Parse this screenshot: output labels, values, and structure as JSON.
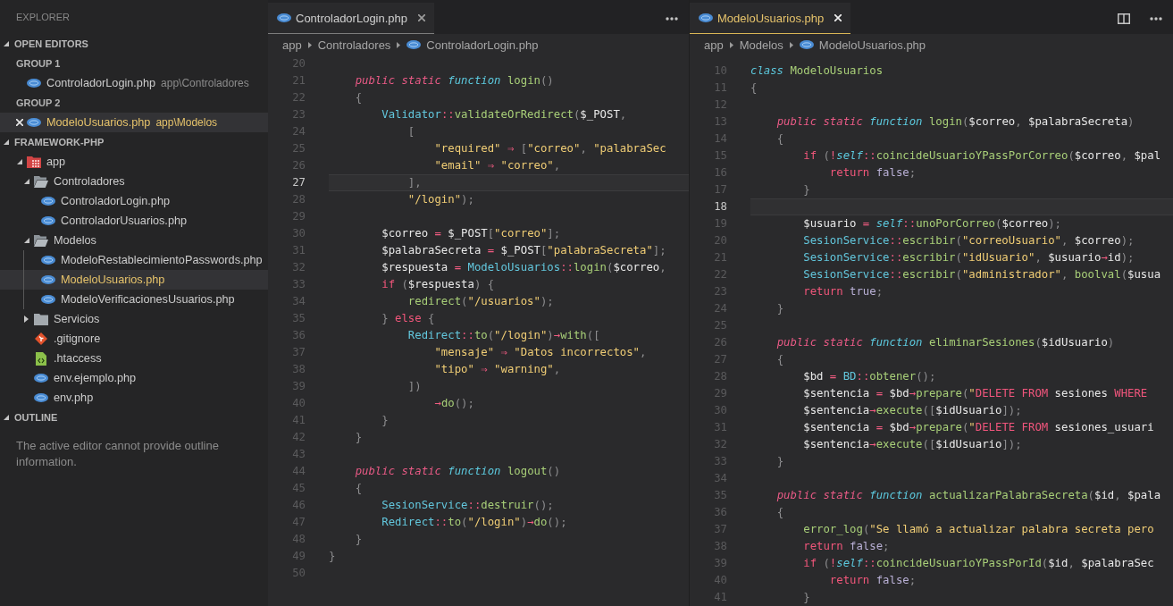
{
  "sidebar": {
    "title": "EXPLORER",
    "open_editors": {
      "title": "OPEN EDITORS",
      "expanded": true,
      "groups": [
        {
          "title": "GROUP 1",
          "files": [
            {
              "name": "ControladorLogin.php",
              "path": "app\\Controladores",
              "kind": "php",
              "selected": false,
              "modified": false
            }
          ]
        },
        {
          "title": "GROUP 2",
          "files": [
            {
              "name": "ModeloUsuarios.php",
              "path": "app\\Modelos",
              "kind": "php",
              "selected": true,
              "modified": true
            }
          ]
        }
      ]
    },
    "folder": {
      "title": "FRAMEWORK-PHP",
      "expanded": true,
      "tree": [
        {
          "name": "app",
          "kind": "module",
          "expanded": true,
          "selected": false,
          "modified": false,
          "children": [
            {
              "name": "Controladores",
              "kind": "folder",
              "expanded": true,
              "selected": false,
              "modified": false,
              "children": [
                {
                  "name": "ControladorLogin.php",
                  "kind": "php",
                  "selected": false,
                  "modified": false
                },
                {
                  "name": "ControladorUsuarios.php",
                  "kind": "php",
                  "selected": false,
                  "modified": false
                }
              ]
            },
            {
              "name": "Modelos",
              "kind": "folder",
              "expanded": true,
              "selected": false,
              "modified": false,
              "children": [
                {
                  "name": "ModeloRestablecimientoPasswords.php",
                  "kind": "php",
                  "selected": false,
                  "modified": false
                },
                {
                  "name": "ModeloUsuarios.php",
                  "kind": "php",
                  "selected": true,
                  "modified": true
                },
                {
                  "name": "ModeloVerificacionesUsuarios.php",
                  "kind": "php",
                  "selected": false,
                  "modified": false
                }
              ]
            },
            {
              "name": "Servicios",
              "kind": "folder",
              "expanded": false,
              "selected": false,
              "modified": false
            },
            {
              "name": ".gitignore",
              "kind": "git",
              "selected": false,
              "modified": false
            },
            {
              "name": ".htaccess",
              "kind": "config",
              "selected": false,
              "modified": false
            },
            {
              "name": "env.ejemplo.php",
              "kind": "php",
              "selected": false,
              "modified": false
            },
            {
              "name": "env.php",
              "kind": "php",
              "selected": false,
              "modified": false
            }
          ]
        }
      ]
    },
    "outline": {
      "title": "OUTLINE",
      "expanded": true,
      "message": "The active editor cannot provide outline information."
    }
  },
  "editor_groups": [
    {
      "focused": false,
      "tabs": [
        {
          "label": "ControladorLogin.php",
          "kind": "php",
          "selected": true,
          "modified": false
        }
      ],
      "actions": [
        {
          "kind": "more"
        }
      ],
      "breadcrumbs": [
        {
          "kind": "folder",
          "text": "app"
        },
        {
          "kind": "folder",
          "text": "Controladores"
        },
        {
          "kind": "php",
          "text": "ControladorLogin.php"
        }
      ],
      "lines": [
        {
          "number": "20",
          "current": false
        },
        {
          "number": "21",
          "current": false,
          "tokens": [
            {
              "kind": "mod",
              "text": "    public static "
            },
            {
              "kind": "decl",
              "text": "function "
            },
            {
              "kind": "call",
              "text": "login"
            },
            {
              "kind": "punc",
              "text": "()"
            }
          ]
        },
        {
          "number": "22",
          "current": false,
          "tokens": [
            {
              "kind": "punc",
              "text": "    {"
            }
          ]
        },
        {
          "number": "23",
          "current": false,
          "tokens": [
            {
              "kind": "type",
              "text": "        Validator"
            },
            {
              "kind": "op",
              "text": "::"
            },
            {
              "kind": "call",
              "text": "validateOrRedirect"
            },
            {
              "kind": "punc",
              "text": "("
            },
            {
              "kind": "var",
              "text": "$_POST"
            },
            {
              "kind": "punc",
              "text": ","
            }
          ]
        },
        {
          "number": "24",
          "current": false,
          "tokens": [
            {
              "kind": "punc",
              "text": "            ["
            }
          ]
        },
        {
          "number": "25",
          "current": false,
          "tokens": [
            {
              "kind": "str",
              "text": "                \"required\""
            },
            {
              "kind": "op",
              "text": " ⇒ "
            },
            {
              "kind": "punc",
              "text": "["
            },
            {
              "kind": "str",
              "text": "\"correo\""
            },
            {
              "kind": "punc",
              "text": ", "
            },
            {
              "kind": "str",
              "text": "\"palabraSec"
            }
          ]
        },
        {
          "number": "26",
          "current": false,
          "tokens": [
            {
              "kind": "str",
              "text": "                \"email\""
            },
            {
              "kind": "op",
              "text": " ⇒ "
            },
            {
              "kind": "str",
              "text": "\"correo\""
            },
            {
              "kind": "punc",
              "text": ","
            }
          ]
        },
        {
          "number": "27",
          "current": true,
          "tokens": [
            {
              "kind": "punc",
              "text": "            ],"
            }
          ]
        },
        {
          "number": "28",
          "current": false,
          "tokens": [
            {
              "kind": "str",
              "text": "            \"/login\""
            },
            {
              "kind": "punc",
              "text": ");"
            }
          ]
        },
        {
          "number": "29",
          "current": false
        },
        {
          "number": "30",
          "current": false,
          "tokens": [
            {
              "kind": "var",
              "text": "        $correo"
            },
            {
              "kind": "op",
              "text": " = "
            },
            {
              "kind": "var",
              "text": "$_POST"
            },
            {
              "kind": "punc",
              "text": "["
            },
            {
              "kind": "str",
              "text": "\"correo\""
            },
            {
              "kind": "punc",
              "text": "];"
            }
          ]
        },
        {
          "number": "31",
          "current": false,
          "tokens": [
            {
              "kind": "var",
              "text": "        $palabraSecreta"
            },
            {
              "kind": "op",
              "text": " = "
            },
            {
              "kind": "var",
              "text": "$_POST"
            },
            {
              "kind": "punc",
              "text": "["
            },
            {
              "kind": "str",
              "text": "\"palabraSecreta\""
            },
            {
              "kind": "punc",
              "text": "];"
            }
          ]
        },
        {
          "number": "32",
          "current": false,
          "tokens": [
            {
              "kind": "var",
              "text": "        $respuesta"
            },
            {
              "kind": "op",
              "text": " = "
            },
            {
              "kind": "type",
              "text": "ModeloUsuarios"
            },
            {
              "kind": "op",
              "text": "::"
            },
            {
              "kind": "call",
              "text": "login"
            },
            {
              "kind": "punc",
              "text": "("
            },
            {
              "kind": "var",
              "text": "$correo"
            },
            {
              "kind": "punc",
              "text": ","
            }
          ]
        },
        {
          "number": "33",
          "current": false,
          "tokens": [
            {
              "kind": "ctl",
              "text": "        if"
            },
            {
              "kind": "punc",
              "text": " ("
            },
            {
              "kind": "var",
              "text": "$respuesta"
            },
            {
              "kind": "punc",
              "text": ") {"
            }
          ]
        },
        {
          "number": "34",
          "current": false,
          "tokens": [
            {
              "kind": "call",
              "text": "            redirect"
            },
            {
              "kind": "punc",
              "text": "("
            },
            {
              "kind": "str",
              "text": "\"/usuarios\""
            },
            {
              "kind": "punc",
              "text": ");"
            }
          ]
        },
        {
          "number": "35",
          "current": false,
          "tokens": [
            {
              "kind": "punc",
              "text": "        } "
            },
            {
              "kind": "ctl",
              "text": "else"
            },
            {
              "kind": "punc",
              "text": " {"
            }
          ]
        },
        {
          "number": "36",
          "current": false,
          "tokens": [
            {
              "kind": "type",
              "text": "            Redirect"
            },
            {
              "kind": "op",
              "text": "::"
            },
            {
              "kind": "call",
              "text": "to"
            },
            {
              "kind": "punc",
              "text": "("
            },
            {
              "kind": "str",
              "text": "\"/login\""
            },
            {
              "kind": "punc",
              "text": ")"
            },
            {
              "kind": "op",
              "text": "→"
            },
            {
              "kind": "call",
              "text": "with"
            },
            {
              "kind": "punc",
              "text": "(["
            }
          ]
        },
        {
          "number": "37",
          "current": false,
          "tokens": [
            {
              "kind": "str",
              "text": "                \"mensaje\""
            },
            {
              "kind": "op",
              "text": " ⇒ "
            },
            {
              "kind": "str",
              "text": "\"Datos incorrectos\""
            },
            {
              "kind": "punc",
              "text": ","
            }
          ]
        },
        {
          "number": "38",
          "current": false,
          "tokens": [
            {
              "kind": "str",
              "text": "                \"tipo\""
            },
            {
              "kind": "op",
              "text": " ⇒ "
            },
            {
              "kind": "str",
              "text": "\"warning\""
            },
            {
              "kind": "punc",
              "text": ","
            }
          ]
        },
        {
          "number": "39",
          "current": false,
          "tokens": [
            {
              "kind": "punc",
              "text": "            ])"
            }
          ]
        },
        {
          "number": "40",
          "current": false,
          "tokens": [
            {
              "kind": "op",
              "text": "                →"
            },
            {
              "kind": "call",
              "text": "do"
            },
            {
              "kind": "punc",
              "text": "();"
            }
          ]
        },
        {
          "number": "41",
          "current": false,
          "tokens": [
            {
              "kind": "punc",
              "text": "        }"
            }
          ]
        },
        {
          "number": "42",
          "current": false,
          "tokens": [
            {
              "kind": "punc",
              "text": "    }"
            }
          ]
        },
        {
          "number": "43",
          "current": false
        },
        {
          "number": "44",
          "current": false,
          "tokens": [
            {
              "kind": "mod",
              "text": "    public static "
            },
            {
              "kind": "decl",
              "text": "function "
            },
            {
              "kind": "call",
              "text": "logout"
            },
            {
              "kind": "punc",
              "text": "()"
            }
          ]
        },
        {
          "number": "45",
          "current": false,
          "tokens": [
            {
              "kind": "punc",
              "text": "    {"
            }
          ]
        },
        {
          "number": "46",
          "current": false,
          "tokens": [
            {
              "kind": "type",
              "text": "        SesionService"
            },
            {
              "kind": "op",
              "text": "::"
            },
            {
              "kind": "call",
              "text": "destruir"
            },
            {
              "kind": "punc",
              "text": "();"
            }
          ]
        },
        {
          "number": "47",
          "current": false,
          "tokens": [
            {
              "kind": "type",
              "text": "        Redirect"
            },
            {
              "kind": "op",
              "text": "::"
            },
            {
              "kind": "call",
              "text": "to"
            },
            {
              "kind": "punc",
              "text": "("
            },
            {
              "kind": "str",
              "text": "\"/login\""
            },
            {
              "kind": "punc",
              "text": ")"
            },
            {
              "kind": "op",
              "text": "→"
            },
            {
              "kind": "call",
              "text": "do"
            },
            {
              "kind": "punc",
              "text": "();"
            }
          ]
        },
        {
          "number": "48",
          "current": false,
          "tokens": [
            {
              "kind": "punc",
              "text": "    }"
            }
          ]
        },
        {
          "number": "49",
          "current": false,
          "tokens": [
            {
              "kind": "punc",
              "text": "}"
            }
          ]
        },
        {
          "number": "50",
          "current": false
        }
      ]
    },
    {
      "focused": true,
      "tabs": [
        {
          "label": "ModeloUsuarios.php",
          "kind": "php",
          "selected": true,
          "modified": true
        }
      ],
      "actions": [
        {
          "kind": "split"
        },
        {
          "kind": "more"
        }
      ],
      "breadcrumbs": [
        {
          "kind": "folder",
          "text": "app"
        },
        {
          "kind": "folder",
          "text": "Modelos"
        },
        {
          "kind": "php",
          "text": "ModeloUsuarios.php"
        }
      ],
      "lines": [
        {
          "number": "10",
          "current": false,
          "tokens": [
            {
              "kind": "decl",
              "text": "class "
            },
            {
              "kind": "call",
              "text": "ModeloUsuarios"
            }
          ]
        },
        {
          "number": "11",
          "current": false,
          "tokens": [
            {
              "kind": "punc",
              "text": "{"
            }
          ]
        },
        {
          "number": "12",
          "current": false
        },
        {
          "number": "13",
          "current": false,
          "tokens": [
            {
              "kind": "mod",
              "text": "    public static "
            },
            {
              "kind": "decl",
              "text": "function "
            },
            {
              "kind": "call",
              "text": "login"
            },
            {
              "kind": "punc",
              "text": "("
            },
            {
              "kind": "var",
              "text": "$correo"
            },
            {
              "kind": "punc",
              "text": ", "
            },
            {
              "kind": "var",
              "text": "$palabraSecreta"
            },
            {
              "kind": "punc",
              "text": ")"
            }
          ]
        },
        {
          "number": "14",
          "current": false,
          "tokens": [
            {
              "kind": "punc",
              "text": "    {"
            }
          ]
        },
        {
          "number": "15",
          "current": false,
          "tokens": [
            {
              "kind": "ctl",
              "text": "        if"
            },
            {
              "kind": "punc",
              "text": " ("
            },
            {
              "kind": "op",
              "text": "!"
            },
            {
              "kind": "decl",
              "text": "self"
            },
            {
              "kind": "op",
              "text": "::"
            },
            {
              "kind": "call",
              "text": "coincideUsuarioYPassPorCorreo"
            },
            {
              "kind": "punc",
              "text": "("
            },
            {
              "kind": "var",
              "text": "$correo"
            },
            {
              "kind": "punc",
              "text": ", "
            },
            {
              "kind": "var",
              "text": "$pal"
            }
          ]
        },
        {
          "number": "16",
          "current": false,
          "tokens": [
            {
              "kind": "ctl",
              "text": "            return "
            },
            {
              "kind": "const",
              "text": "false"
            },
            {
              "kind": "punc",
              "text": ";"
            }
          ]
        },
        {
          "number": "17",
          "current": false,
          "tokens": [
            {
              "kind": "punc",
              "text": "        }"
            }
          ]
        },
        {
          "number": "18",
          "current": true
        },
        {
          "number": "19",
          "current": false,
          "tokens": [
            {
              "kind": "var",
              "text": "        $usuario"
            },
            {
              "kind": "op",
              "text": " = "
            },
            {
              "kind": "decl",
              "text": "self"
            },
            {
              "kind": "op",
              "text": "::"
            },
            {
              "kind": "call",
              "text": "unoPorCorreo"
            },
            {
              "kind": "punc",
              "text": "("
            },
            {
              "kind": "var",
              "text": "$correo"
            },
            {
              "kind": "punc",
              "text": ");"
            }
          ]
        },
        {
          "number": "20",
          "current": false,
          "tokens": [
            {
              "kind": "type",
              "text": "        SesionService"
            },
            {
              "kind": "op",
              "text": "::"
            },
            {
              "kind": "call",
              "text": "escribir"
            },
            {
              "kind": "punc",
              "text": "("
            },
            {
              "kind": "str",
              "text": "\"correoUsuario\""
            },
            {
              "kind": "punc",
              "text": ", "
            },
            {
              "kind": "var",
              "text": "$correo"
            },
            {
              "kind": "punc",
              "text": ");"
            }
          ]
        },
        {
          "number": "21",
          "current": false,
          "tokens": [
            {
              "kind": "type",
              "text": "        SesionService"
            },
            {
              "kind": "op",
              "text": "::"
            },
            {
              "kind": "call",
              "text": "escribir"
            },
            {
              "kind": "punc",
              "text": "("
            },
            {
              "kind": "str",
              "text": "\"idUsuario\""
            },
            {
              "kind": "punc",
              "text": ", "
            },
            {
              "kind": "var",
              "text": "$usuario"
            },
            {
              "kind": "op",
              "text": "→"
            },
            {
              "kind": "var",
              "text": "id"
            },
            {
              "kind": "punc",
              "text": ");"
            }
          ]
        },
        {
          "number": "22",
          "current": false,
          "tokens": [
            {
              "kind": "type",
              "text": "        SesionService"
            },
            {
              "kind": "op",
              "text": "::"
            },
            {
              "kind": "call",
              "text": "escribir"
            },
            {
              "kind": "punc",
              "text": "("
            },
            {
              "kind": "str",
              "text": "\"administrador\""
            },
            {
              "kind": "punc",
              "text": ", "
            },
            {
              "kind": "call",
              "text": "boolval"
            },
            {
              "kind": "punc",
              "text": "("
            },
            {
              "kind": "var",
              "text": "$usua"
            }
          ]
        },
        {
          "number": "23",
          "current": false,
          "tokens": [
            {
              "kind": "ctl",
              "text": "        return "
            },
            {
              "kind": "const",
              "text": "true"
            },
            {
              "kind": "punc",
              "text": ";"
            }
          ]
        },
        {
          "number": "24",
          "current": false,
          "tokens": [
            {
              "kind": "punc",
              "text": "    }"
            }
          ]
        },
        {
          "number": "25",
          "current": false
        },
        {
          "number": "26",
          "current": false,
          "tokens": [
            {
              "kind": "mod",
              "text": "    public static "
            },
            {
              "kind": "decl",
              "text": "function "
            },
            {
              "kind": "call",
              "text": "eliminarSesiones"
            },
            {
              "kind": "punc",
              "text": "("
            },
            {
              "kind": "var",
              "text": "$idUsuario"
            },
            {
              "kind": "punc",
              "text": ")"
            }
          ]
        },
        {
          "number": "27",
          "current": false,
          "tokens": [
            {
              "kind": "punc",
              "text": "    {"
            }
          ]
        },
        {
          "number": "28",
          "current": false,
          "tokens": [
            {
              "kind": "var",
              "text": "        $bd"
            },
            {
              "kind": "op",
              "text": " = "
            },
            {
              "kind": "type",
              "text": "BD"
            },
            {
              "kind": "op",
              "text": "::"
            },
            {
              "kind": "call",
              "text": "obtener"
            },
            {
              "kind": "punc",
              "text": "();"
            }
          ]
        },
        {
          "number": "29",
          "current": false,
          "tokens": [
            {
              "kind": "var",
              "text": "        $sentencia"
            },
            {
              "kind": "op",
              "text": " = "
            },
            {
              "kind": "var",
              "text": "$bd"
            },
            {
              "kind": "op",
              "text": "→"
            },
            {
              "kind": "call",
              "text": "prepare"
            },
            {
              "kind": "punc",
              "text": "("
            },
            {
              "kind": "str",
              "text": "\""
            },
            {
              "kind": "sql",
              "text": "DELETE FROM "
            },
            {
              "kind": "ident",
              "text": "sesiones "
            },
            {
              "kind": "sql",
              "text": "WHERE"
            }
          ]
        },
        {
          "number": "30",
          "current": false,
          "tokens": [
            {
              "kind": "var",
              "text": "        $sentencia"
            },
            {
              "kind": "op",
              "text": "→"
            },
            {
              "kind": "call",
              "text": "execute"
            },
            {
              "kind": "punc",
              "text": "(["
            },
            {
              "kind": "var",
              "text": "$idUsuario"
            },
            {
              "kind": "punc",
              "text": "]);"
            }
          ]
        },
        {
          "number": "31",
          "current": false,
          "tokens": [
            {
              "kind": "var",
              "text": "        $sentencia"
            },
            {
              "kind": "op",
              "text": " = "
            },
            {
              "kind": "var",
              "text": "$bd"
            },
            {
              "kind": "op",
              "text": "→"
            },
            {
              "kind": "call",
              "text": "prepare"
            },
            {
              "kind": "punc",
              "text": "("
            },
            {
              "kind": "str",
              "text": "\""
            },
            {
              "kind": "sql",
              "text": "DELETE FROM "
            },
            {
              "kind": "ident",
              "text": "sesiones_usuari"
            }
          ]
        },
        {
          "number": "32",
          "current": false,
          "tokens": [
            {
              "kind": "var",
              "text": "        $sentencia"
            },
            {
              "kind": "op",
              "text": "→"
            },
            {
              "kind": "call",
              "text": "execute"
            },
            {
              "kind": "punc",
              "text": "(["
            },
            {
              "kind": "var",
              "text": "$idUsuario"
            },
            {
              "kind": "punc",
              "text": "]);"
            }
          ]
        },
        {
          "number": "33",
          "current": false,
          "tokens": [
            {
              "kind": "punc",
              "text": "    }"
            }
          ]
        },
        {
          "number": "34",
          "current": false
        },
        {
          "number": "35",
          "current": false,
          "tokens": [
            {
              "kind": "mod",
              "text": "    public static "
            },
            {
              "kind": "decl",
              "text": "function "
            },
            {
              "kind": "call",
              "text": "actualizarPalabraSecreta"
            },
            {
              "kind": "punc",
              "text": "("
            },
            {
              "kind": "var",
              "text": "$id"
            },
            {
              "kind": "punc",
              "text": ", "
            },
            {
              "kind": "var",
              "text": "$pala"
            }
          ]
        },
        {
          "number": "36",
          "current": false,
          "tokens": [
            {
              "kind": "punc",
              "text": "    {"
            }
          ]
        },
        {
          "number": "37",
          "current": false,
          "tokens": [
            {
              "kind": "call",
              "text": "        error_log"
            },
            {
              "kind": "punc",
              "text": "("
            },
            {
              "kind": "str",
              "text": "\"Se llamó a actualizar palabra secreta pero"
            }
          ]
        },
        {
          "number": "38",
          "current": false,
          "tokens": [
            {
              "kind": "ctl",
              "text": "        return "
            },
            {
              "kind": "const",
              "text": "false"
            },
            {
              "kind": "punc",
              "text": ";"
            }
          ]
        },
        {
          "number": "39",
          "current": false,
          "tokens": [
            {
              "kind": "ctl",
              "text": "        if"
            },
            {
              "kind": "punc",
              "text": " ("
            },
            {
              "kind": "op",
              "text": "!"
            },
            {
              "kind": "decl",
              "text": "self"
            },
            {
              "kind": "op",
              "text": "::"
            },
            {
              "kind": "call",
              "text": "coincideUsuarioYPassPorId"
            },
            {
              "kind": "punc",
              "text": "("
            },
            {
              "kind": "var",
              "text": "$id"
            },
            {
              "kind": "punc",
              "text": ", "
            },
            {
              "kind": "var",
              "text": "$palabraSec"
            }
          ]
        },
        {
          "number": "40",
          "current": false,
          "tokens": [
            {
              "kind": "ctl",
              "text": "            return "
            },
            {
              "kind": "const",
              "text": "false"
            },
            {
              "kind": "punc",
              "text": ";"
            }
          ]
        },
        {
          "number": "41",
          "current": false,
          "tokens": [
            {
              "kind": "punc",
              "text": "        }"
            }
          ]
        }
      ]
    }
  ]
}
